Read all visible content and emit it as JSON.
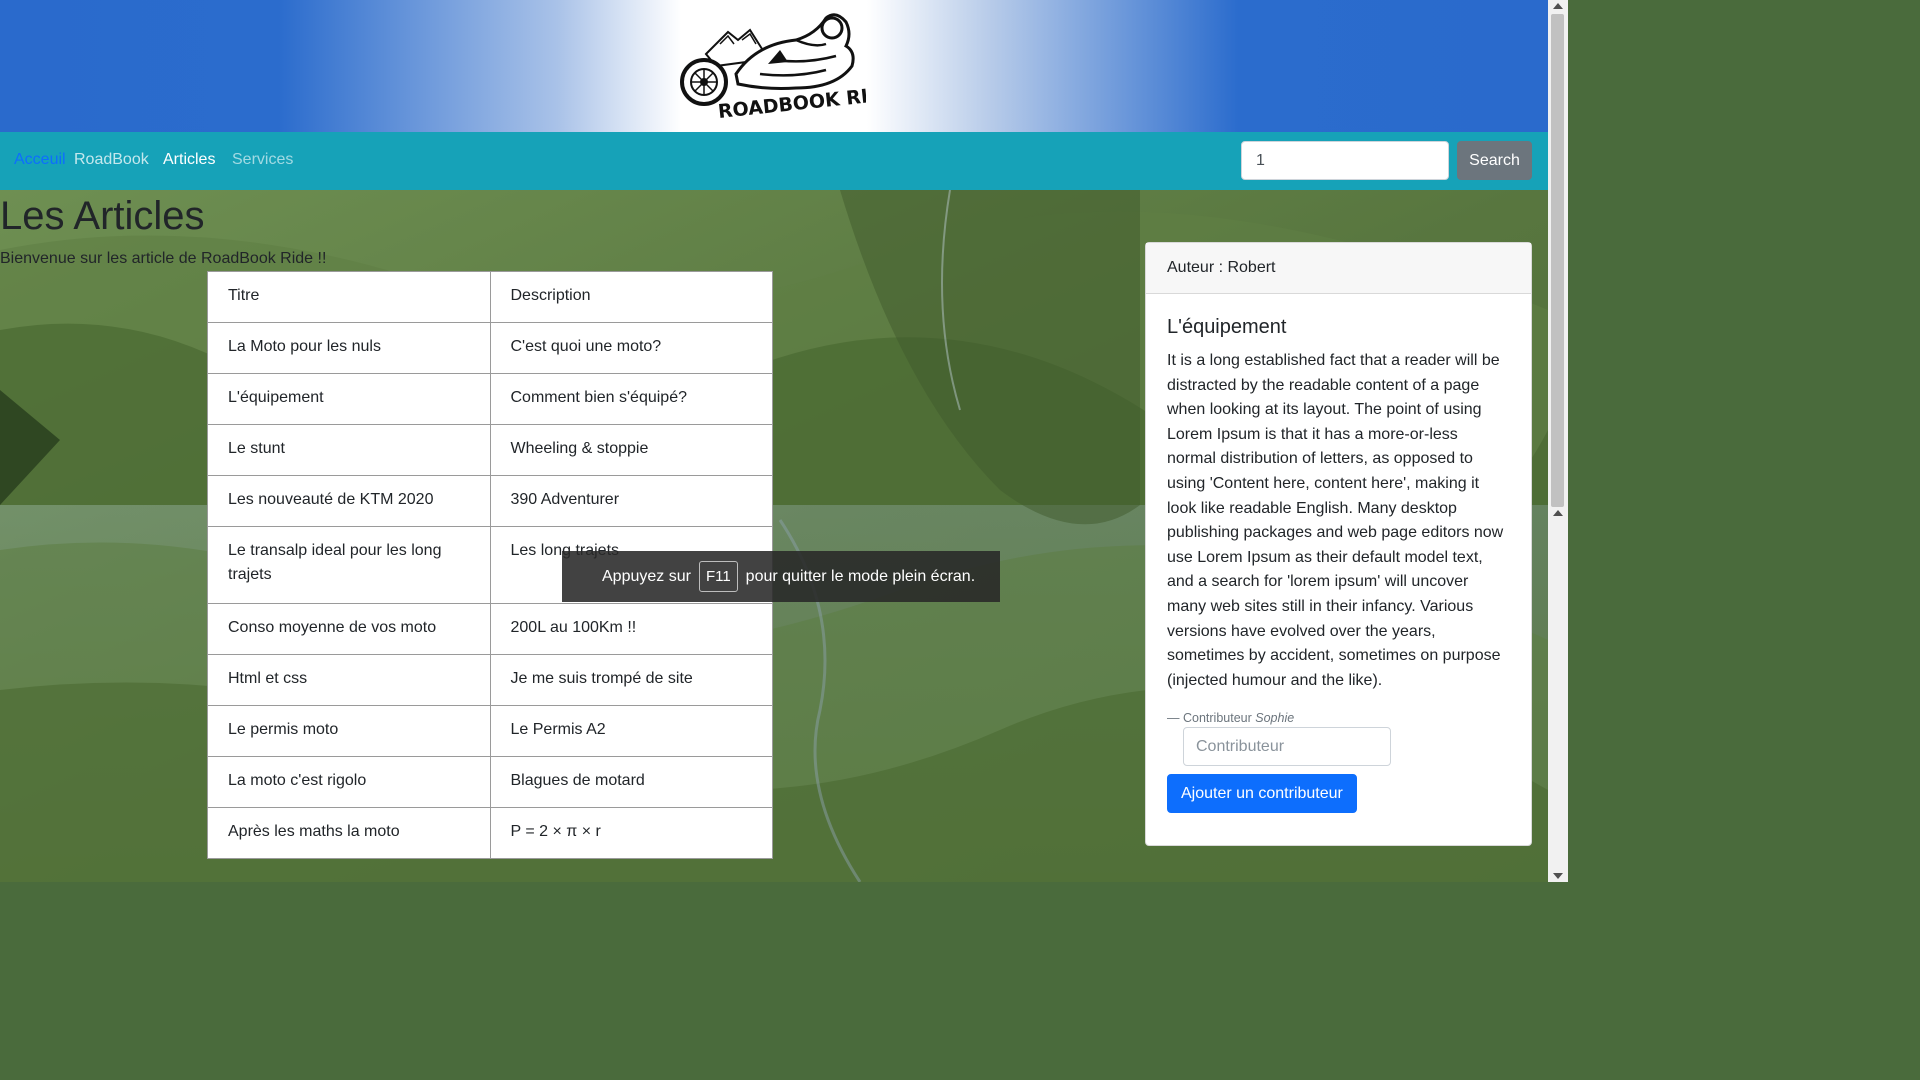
{
  "nav": {
    "items": [
      {
        "label": "Acceuil"
      },
      {
        "label": "RoadBook"
      },
      {
        "label": "Articles"
      },
      {
        "label": "Services"
      }
    ],
    "search_value": "1",
    "search_button": "Search"
  },
  "logo": {
    "text": "ROADBOOK RIDE"
  },
  "page": {
    "title": "Les Articles",
    "subtitle": "Bienvenue sur les article de RoadBook Ride !!"
  },
  "table": {
    "headers": [
      "Titre",
      "Description"
    ],
    "rows": [
      {
        "titre": "La Moto pour les nuls",
        "description": "C'est quoi une moto?"
      },
      {
        "titre": "L'équipement",
        "description": "Comment bien s'équipé?"
      },
      {
        "titre": "Le stunt",
        "description": "Wheeling & stoppie"
      },
      {
        "titre": "Les nouveauté de KTM 2020",
        "description": "390 Adventurer"
      },
      {
        "titre": "Le transalp ideal pour les long trajets",
        "description": "Les long trajets"
      },
      {
        "titre": "Conso moyenne de vos moto",
        "description": "200L au 100Km !!"
      },
      {
        "titre": "Html et css",
        "description": "Je me suis trompé de site"
      },
      {
        "titre": "Le permis moto",
        "description": "Le Permis A2"
      },
      {
        "titre": "La moto c'est rigolo",
        "description": "Blagues de motard"
      },
      {
        "titre": "Après les maths la moto",
        "description": "P = 2 × π × r"
      }
    ]
  },
  "card": {
    "header": "Auteur : Robert",
    "title": "L'équipement",
    "text": "It is a long established fact that a reader will be distracted by the readable content of a page when looking at its layout. The point of using Lorem Ipsum is that it has a more-or-less normal distribution of letters, as opposed to using 'Content here, content here', making it look like readable English. Many desktop publishing packages and web page editors now use Lorem Ipsum as their default model text, and a search for 'lorem ipsum' will uncover many web sites still in their infancy. Various versions have evolved over the years, sometimes by accident, sometimes on purpose (injected humour and the like).",
    "footer_prefix": "— Contributeur",
    "footer_name": "Sophie",
    "contrib_placeholder": "Contributeur",
    "contrib_button": "Ajouter un contributeur"
  },
  "toast": {
    "before": "Appuyez sur",
    "key": "F11",
    "after": "pour quitter le mode plein écran."
  },
  "colors": {
    "navbar": "#16a2b8",
    "banner_blue": "#2a6acc",
    "primary": "#0d6efd",
    "secondary": "#6c757d"
  }
}
